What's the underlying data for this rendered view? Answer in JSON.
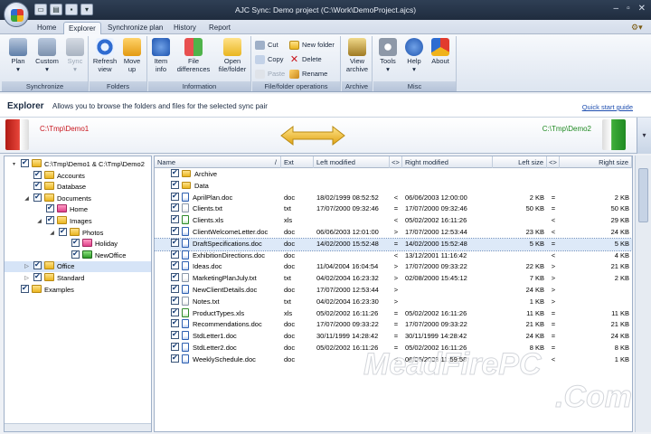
{
  "window": {
    "title": "AJC Sync: Demo project (C:\\Work\\DemoProject.ajcs)",
    "controls": [
      "–",
      "▫",
      "✕"
    ]
  },
  "ribbon_tabs": [
    "Home",
    "Explorer",
    "Synchronize plan",
    "History",
    "Report"
  ],
  "active_tab": "Explorer",
  "ribbon": {
    "synchronize": {
      "label": "Synchronize",
      "plan": "Plan",
      "custom": "Custom",
      "sync": "Sync"
    },
    "folders": {
      "label": "Folders",
      "refresh": "Refresh\nview",
      "move_up": "Move\nup"
    },
    "information": {
      "label": "Information",
      "item_info": "Item\ninfo",
      "file_differences": "File\ndifferences",
      "open": "Open\nfile/folder"
    },
    "file_ops": {
      "label": "File/folder operations",
      "cut": "Cut",
      "copy": "Copy",
      "paste": "Paste",
      "new_folder": "New folder",
      "delete": "Delete",
      "rename": "Rename"
    },
    "archive": {
      "label": "Archive",
      "view_archive": "View\narchive"
    },
    "misc": {
      "label": "Misc",
      "tools": "Tools",
      "help": "Help",
      "about": "About"
    }
  },
  "explorer_header": {
    "title": "Explorer",
    "description": "Allows you to browse the folders and files for the selected sync pair",
    "quick_start": "Quick start guide"
  },
  "pair": {
    "left": "C:\\Tmp\\Demo1",
    "right": "C:\\Tmp\\Demo2"
  },
  "tree": [
    {
      "label": "C:\\Tmp\\Demo1 & C:\\Tmp\\Demo2",
      "level": 0,
      "expander": "▾",
      "color": "yel"
    },
    {
      "label": "Accounts",
      "level": 1,
      "expander": "",
      "color": "yel"
    },
    {
      "label": "Database",
      "level": 1,
      "expander": "",
      "color": "yel"
    },
    {
      "label": "Documents",
      "level": 1,
      "expander": "◢",
      "color": "yel"
    },
    {
      "label": "Home",
      "level": 2,
      "expander": "",
      "color": "pink"
    },
    {
      "label": "Images",
      "level": 2,
      "expander": "◢",
      "color": "yel"
    },
    {
      "label": "Photos",
      "level": 3,
      "expander": "◢",
      "color": "yel"
    },
    {
      "label": "Holiday",
      "level": 4,
      "expander": "",
      "color": "pink"
    },
    {
      "label": "NewOffice",
      "level": 4,
      "expander": "",
      "color": "grn"
    },
    {
      "label": "Office",
      "level": 1,
      "expander": "▷",
      "color": "yel",
      "selected": true
    },
    {
      "label": "Standard",
      "level": 1,
      "expander": "▷",
      "color": "yel"
    },
    {
      "label": "Examples",
      "level": 0,
      "expander": "",
      "color": "yel"
    }
  ],
  "columns": {
    "name": "Name",
    "sort": "/",
    "ext": "Ext",
    "left_modified": "Left modified",
    "cmp_date": "<>",
    "right_modified": "Right modified",
    "left_size": "Left size",
    "cmp_size": "<>",
    "right_size": "Right size"
  },
  "files": [
    {
      "name": "Archive",
      "icon": "folder",
      "ext": "",
      "lm": "",
      "cd": "",
      "rm": "",
      "ls": "",
      "cs": "",
      "rs": ""
    },
    {
      "name": "Data",
      "icon": "folder",
      "ext": "",
      "lm": "",
      "cd": "",
      "rm": "",
      "ls": "",
      "cs": "",
      "rs": ""
    },
    {
      "name": "AprilPlan.doc",
      "icon": "doc",
      "ext": "doc",
      "lm": "18/02/1999 08:52:52",
      "cd": "<",
      "rm": "06/06/2003 12:00:00",
      "ls": "2 KB",
      "cs": "=",
      "rs": "2 KB"
    },
    {
      "name": "Clients.txt",
      "icon": "txt",
      "ext": "txt",
      "lm": "17/07/2000 09:32:46",
      "cd": "=",
      "rm": "17/07/2000 09:32:46",
      "ls": "50 KB",
      "cs": "=",
      "rs": "50 KB"
    },
    {
      "name": "Clients.xls",
      "icon": "xls",
      "ext": "xls",
      "lm": "",
      "cd": "<",
      "rm": "05/02/2002 16:11:26",
      "ls": "",
      "cs": "<",
      "rs": "29 KB"
    },
    {
      "name": "ClientWelcomeLetter.doc",
      "icon": "doc",
      "ext": "doc",
      "lm": "06/06/2003 12:01:00",
      "cd": ">",
      "rm": "17/07/2000 12:53:44",
      "ls": "23 KB",
      "cs": "<",
      "rs": "24 KB"
    },
    {
      "name": "DraftSpecifications.doc",
      "icon": "doc",
      "ext": "doc",
      "lm": "14/02/2000 15:52:48",
      "cd": "=",
      "rm": "14/02/2000 15:52:48",
      "ls": "5 KB",
      "cs": "=",
      "rs": "5 KB",
      "selected": true
    },
    {
      "name": "ExhibitionDirections.doc",
      "icon": "doc",
      "ext": "doc",
      "lm": "",
      "cd": "<",
      "rm": "13/12/2001 11:16:42",
      "ls": "",
      "cs": "<",
      "rs": "4 KB"
    },
    {
      "name": "Ideas.doc",
      "icon": "doc",
      "ext": "doc",
      "lm": "11/04/2004 16:04:54",
      "cd": ">",
      "rm": "17/07/2000 09:33:22",
      "ls": "22 KB",
      "cs": ">",
      "rs": "21 KB"
    },
    {
      "name": "MarketingPlanJuly.txt",
      "icon": "txt",
      "ext": "txt",
      "lm": "04/02/2004 16:23:32",
      "cd": ">",
      "rm": "02/08/2000 15:45:12",
      "ls": "7 KB",
      "cs": ">",
      "rs": "2 KB"
    },
    {
      "name": "NewClientDetails.doc",
      "icon": "doc",
      "ext": "doc",
      "lm": "17/07/2000 12:53:44",
      "cd": ">",
      "rm": "",
      "ls": "24 KB",
      "cs": ">",
      "rs": ""
    },
    {
      "name": "Notes.txt",
      "icon": "txt",
      "ext": "txt",
      "lm": "04/02/2004 16:23:30",
      "cd": ">",
      "rm": "",
      "ls": "1 KB",
      "cs": ">",
      "rs": ""
    },
    {
      "name": "ProductTypes.xls",
      "icon": "xls",
      "ext": "xls",
      "lm": "05/02/2002 16:11:26",
      "cd": "=",
      "rm": "05/02/2002 16:11:26",
      "ls": "11 KB",
      "cs": "=",
      "rs": "11 KB"
    },
    {
      "name": "Recommendations.doc",
      "icon": "doc",
      "ext": "doc",
      "lm": "17/07/2000 09:33:22",
      "cd": "=",
      "rm": "17/07/2000 09:33:22",
      "ls": "21 KB",
      "cs": "=",
      "rs": "21 KB"
    },
    {
      "name": "StdLetter1.doc",
      "icon": "doc",
      "ext": "doc",
      "lm": "30/11/1999 14:28:42",
      "cd": "=",
      "rm": "30/11/1999 14:28:42",
      "ls": "24 KB",
      "cs": "=",
      "rs": "24 KB"
    },
    {
      "name": "StdLetter2.doc",
      "icon": "doc",
      "ext": "doc",
      "lm": "05/02/2002 16:11:26",
      "cd": "=",
      "rm": "05/02/2002 16:11:26",
      "ls": "8 KB",
      "cs": "=",
      "rs": "8 KB"
    },
    {
      "name": "WeeklySchedule.doc",
      "icon": "doc",
      "ext": "doc",
      "lm": "",
      "cd": "<",
      "rm": "06/06/2003 11:59:58",
      "ls": "",
      "cs": "<",
      "rs": "1 KB"
    }
  ],
  "watermark": {
    "line1": "MeadFirePC",
    "line2": ".Com"
  },
  "colors": {
    "title_bar": "#1f2c3e",
    "left_folder": "#c8141c",
    "right_folder": "#1f8a22",
    "link": "#1f4fb0",
    "selection": "#dde9f8"
  }
}
